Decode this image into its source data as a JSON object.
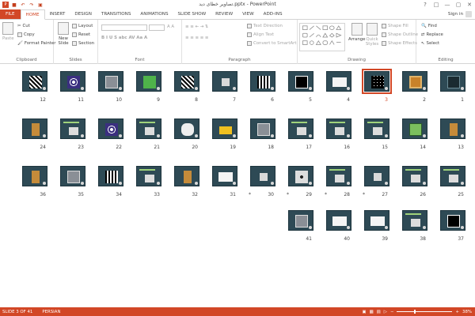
{
  "window": {
    "title": "تصاویر خطاى دید.pptx - PowerPoint",
    "minimize": "—",
    "restore": "▢",
    "close": "✕"
  },
  "tabs": [
    "FILE",
    "HOME",
    "INSERT",
    "DESIGN",
    "TRANSITIONS",
    "ANIMATIONS",
    "SLIDE SHOW",
    "REVIEW",
    "VIEW",
    "ADD-INS"
  ],
  "active_tab": "HOME",
  "signin": "Sign in",
  "ribbon": {
    "clipboard": {
      "label": "Clipboard",
      "paste": "Paste",
      "cut": "Cut",
      "copy": "Copy",
      "format_painter": "Format Painter"
    },
    "slides": {
      "label": "Slides",
      "new_slide": "New Slide",
      "layout": "Layout",
      "reset": "Reset",
      "section": "Section"
    },
    "font": {
      "label": "Font"
    },
    "paragraph": {
      "label": "Paragraph",
      "text_direction": "Text Direction",
      "align_text": "Align Text",
      "convert": "Convert to SmartArt"
    },
    "drawing": {
      "label": "Drawing",
      "arrange": "Arrange",
      "quick_styles": "Quick Styles",
      "shape_fill": "Shape Fill",
      "shape_outline": "Shape Outline",
      "shape_effects": "Shape Effects"
    },
    "editing": {
      "label": "Editing",
      "find": "Find",
      "replace": "Replace",
      "select": "Select"
    }
  },
  "slides": [
    {
      "n": "1",
      "kind": "dark"
    },
    {
      "n": "2",
      "kind": "frame"
    },
    {
      "n": "3",
      "kind": "grid",
      "selected": true
    },
    {
      "n": "4",
      "kind": "white"
    },
    {
      "n": "5",
      "kind": "bw"
    },
    {
      "n": "6",
      "kind": "stripes"
    },
    {
      "n": "7",
      "kind": "plain"
    },
    {
      "n": "8",
      "kind": "checker"
    },
    {
      "n": "9",
      "kind": "green"
    },
    {
      "n": "10",
      "kind": "photo"
    },
    {
      "n": "11",
      "kind": "spiral"
    },
    {
      "n": "12",
      "kind": "checker"
    },
    {
      "n": "13",
      "kind": "figure"
    },
    {
      "n": "14",
      "kind": "green2"
    },
    {
      "n": "15",
      "kind": "text"
    },
    {
      "n": "16",
      "kind": "text"
    },
    {
      "n": "17",
      "kind": "text"
    },
    {
      "n": "18",
      "kind": "photo"
    },
    {
      "n": "19",
      "kind": "yellow"
    },
    {
      "n": "20",
      "kind": "face"
    },
    {
      "n": "21",
      "kind": "text"
    },
    {
      "n": "22",
      "kind": "spiral"
    },
    {
      "n": "23",
      "kind": "text"
    },
    {
      "n": "24",
      "kind": "figure"
    },
    {
      "n": "25",
      "kind": "text"
    },
    {
      "n": "26",
      "kind": "text"
    },
    {
      "n": "27",
      "kind": "plain",
      "star": true
    },
    {
      "n": "28",
      "kind": "text",
      "star": true
    },
    {
      "n": "29",
      "kind": "circles",
      "star": true
    },
    {
      "n": "30",
      "kind": "plain",
      "star": true
    },
    {
      "n": "31",
      "kind": "white"
    },
    {
      "n": "32",
      "kind": "figure"
    },
    {
      "n": "33",
      "kind": "text"
    },
    {
      "n": "34",
      "kind": "stripes"
    },
    {
      "n": "35",
      "kind": "photo"
    },
    {
      "n": "36",
      "kind": "figure"
    },
    {
      "n": "37",
      "kind": "bw"
    },
    {
      "n": "38",
      "kind": "text"
    },
    {
      "n": "39",
      "kind": "white"
    },
    {
      "n": "40",
      "kind": "white"
    },
    {
      "n": "41",
      "kind": "photo"
    }
  ],
  "status": {
    "slide": "SLIDE 3 OF 41",
    "language": "PERSIAN",
    "zoom": "38%"
  },
  "colors": {
    "accent": "#d24726",
    "slide_bg": "#2e4a55"
  }
}
